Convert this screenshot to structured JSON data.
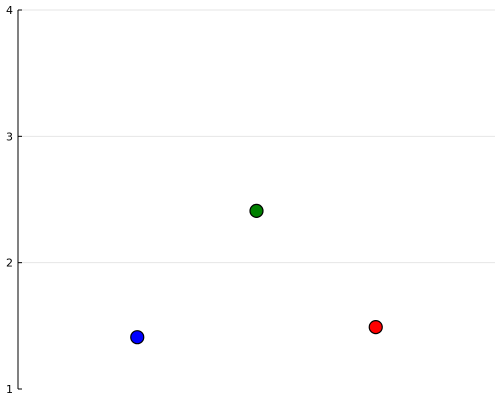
{
  "chart_data": {
    "type": "scatter",
    "title": "",
    "xlabel": "",
    "ylabel": "",
    "grid": true,
    "legend": "none",
    "xlim": [
      0.5,
      4.5
    ],
    "ylim": [
      1,
      4
    ],
    "y_ticks": [
      1,
      2,
      3,
      4
    ],
    "y_tick_labels": [
      "1",
      "2",
      "3",
      "4"
    ],
    "points": [
      {
        "x": 1.5,
        "y": 1.41,
        "color": "#0000ff"
      },
      {
        "x": 2.5,
        "y": 2.41,
        "color": "#008000"
      },
      {
        "x": 3.5,
        "y": 1.49,
        "color": "#ff0000"
      }
    ]
  }
}
